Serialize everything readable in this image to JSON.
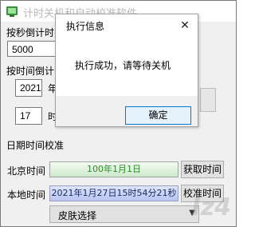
{
  "app": {
    "title": "计时关机和自动校准软件",
    "countdown_seconds_label": "按秒倒计时关",
    "seconds_value": "5000",
    "countdown_time_label": "按时间倒计时",
    "year_value": "2021",
    "year_unit": "年",
    "hour_value": "17",
    "hour_unit": "时",
    "calibration_heading": "日期时间校准",
    "beijing_time_label": "北京时间",
    "beijing_time_value": "100年1月1日",
    "get_time_button": "获取时间",
    "local_time_label": "本地时间",
    "local_time_value": "2021年1月27日15时54分21秒",
    "calibrate_button": "校准时间",
    "skin_select": "皮肤选择"
  },
  "dialog": {
    "title": "执行信息",
    "message": "执行成功，请等待关机",
    "ok_label": "确定"
  },
  "watermark": "Iz4"
}
